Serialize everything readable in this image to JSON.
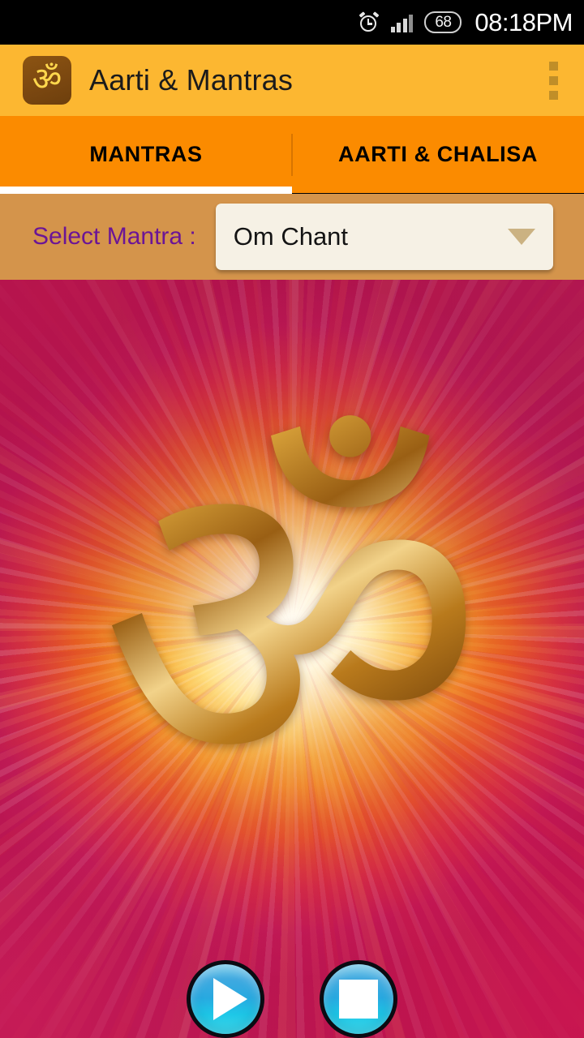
{
  "status_bar": {
    "alarm_icon": "alarm-clock-icon",
    "signal_icon": "cellular-signal-icon",
    "battery_level": "68",
    "time": "08:18PM"
  },
  "app_bar": {
    "icon": "om-app-icon",
    "icon_glyph": "ॐ",
    "title": "Aarti & Mantras",
    "overflow_icon": "overflow-menu-icon",
    "background_color": "#fcb731"
  },
  "tabs": {
    "items": [
      {
        "label": "MANTRAS",
        "active": true
      },
      {
        "label": "AARTI & CHALISA",
        "active": false
      }
    ],
    "background_color": "#fb8b00",
    "indicator_color": "#ffffff"
  },
  "selector": {
    "label": "Select Mantra :",
    "label_color": "#6b1596",
    "background_color": "#d4944b",
    "spinner": {
      "value": "Om Chant",
      "caret_icon": "chevron-down-icon",
      "background_color": "#f6f1e5"
    }
  },
  "artwork": {
    "symbol": "ॐ",
    "description": "golden om symbol on radial light burst",
    "accent_colors": [
      "#ffd24a",
      "#fba516",
      "#d8313c",
      "#b51057"
    ]
  },
  "controls": {
    "play": {
      "icon": "play-icon",
      "label": "Play"
    },
    "stop": {
      "icon": "stop-icon",
      "label": "Stop"
    },
    "button_color": "#28a9e0"
  }
}
